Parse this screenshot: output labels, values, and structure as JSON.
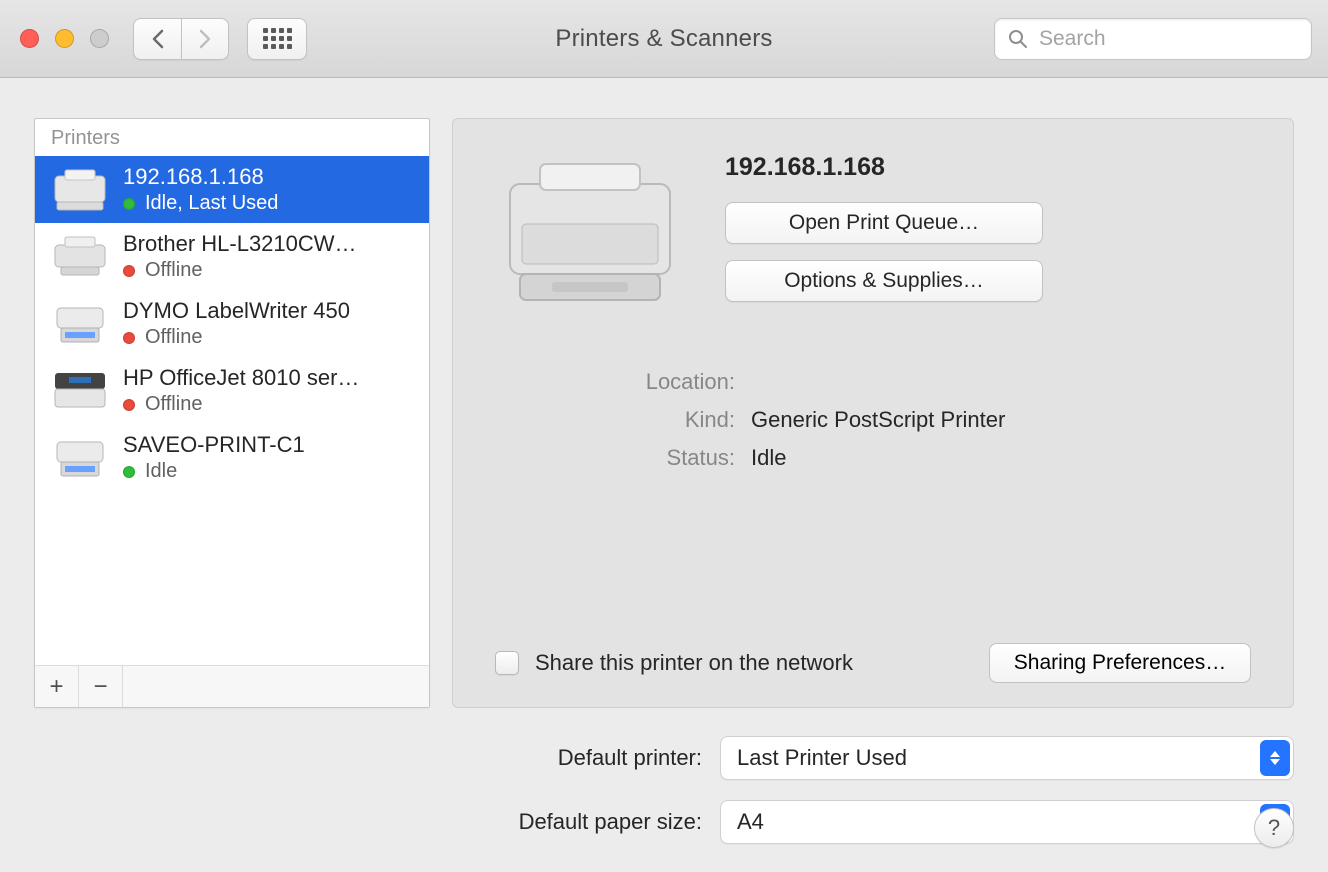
{
  "window": {
    "title": "Printers & Scanners",
    "search_placeholder": "Search"
  },
  "sidebar": {
    "header": "Printers",
    "add_symbol": "+",
    "remove_symbol": "−",
    "printers": [
      {
        "name": "192.168.1.168",
        "status": "Idle, Last Used",
        "status_color": "green",
        "selected": true
      },
      {
        "name": "Brother HL-L3210CW…",
        "status": "Offline",
        "status_color": "red",
        "selected": false
      },
      {
        "name": "DYMO LabelWriter 450",
        "status": "Offline",
        "status_color": "red",
        "selected": false
      },
      {
        "name": "HP OfficeJet 8010 ser…",
        "status": "Offline",
        "status_color": "red",
        "selected": false
      },
      {
        "name": "SAVEO-PRINT-C1",
        "status": "Idle",
        "status_color": "green",
        "selected": false
      }
    ]
  },
  "detail": {
    "title": "192.168.1.168",
    "open_queue_label": "Open Print Queue…",
    "options_supplies_label": "Options & Supplies…",
    "labels": {
      "location": "Location:",
      "kind": "Kind:",
      "status": "Status:"
    },
    "values": {
      "location": "",
      "kind": "Generic PostScript Printer",
      "status": "Idle"
    },
    "share_label": "Share this printer on the network",
    "share_checked": false,
    "sharing_prefs_label": "Sharing Preferences…"
  },
  "defaults": {
    "printer_label": "Default printer:",
    "printer_value": "Last Printer Used",
    "paper_label": "Default paper size:",
    "paper_value": "A4"
  },
  "help_symbol": "?"
}
